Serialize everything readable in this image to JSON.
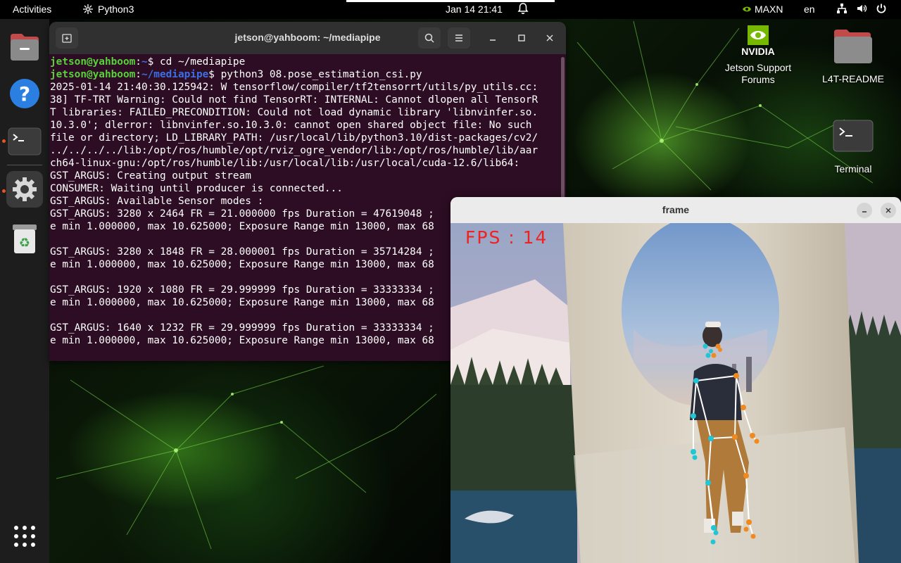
{
  "topbar": {
    "activities": "Activities",
    "app_name": "Python3",
    "clock": "Jan 14  21:41",
    "power_mode": "MAXN",
    "language": "en"
  },
  "dock": {
    "items": [
      {
        "name": "Files",
        "icon": "folder-icon"
      },
      {
        "name": "Help",
        "icon": "help-icon"
      },
      {
        "name": "Terminal",
        "icon": "terminal-icon"
      },
      {
        "name": "Settings",
        "icon": "settings-icon"
      },
      {
        "name": "Trash",
        "icon": "trash-icon"
      }
    ],
    "apps_grid_icon": "apps-grid-icon"
  },
  "desktop": {
    "icons": [
      {
        "label_line1": "Jetson Support",
        "label_line2": "Forums",
        "icon": "nvidia-logo"
      },
      {
        "label_line1": "L4T-README",
        "label_line2": "",
        "icon": "folder-icon"
      },
      {
        "label_line1": "Terminal",
        "label_line2": "",
        "icon": "terminal-icon"
      }
    ],
    "nvidia_logo_text": "NVIDIA"
  },
  "terminal": {
    "title": "jetson@yahboom: ~/mediapipe",
    "prompt_user": "jetson@yahboom",
    "prompt1_path": "~",
    "prompt1_cmd": "$ cd ~/mediapipe",
    "prompt2_path": "~/mediapipe",
    "prompt2_cmd": "$ python3 08.pose_estimation_csi.py",
    "lines": [
      "2025-01-14 21:40:30.125942: W tensorflow/compiler/tf2tensorrt/utils/py_utils.cc:",
      "38] TF-TRT Warning: Could not find TensorRT: INTERNAL: Cannot dlopen all TensorR",
      "T libraries: FAILED_PRECONDITION: Could not load dynamic library 'libnvinfer.so.",
      "10.3.0'; dlerror: libnvinfer.so.10.3.0: cannot open shared object file: No such",
      "file or directory; LD_LIBRARY_PATH: /usr/local/lib/python3.10/dist-packages/cv2/",
      "../../../../lib:/opt/ros/humble/opt/rviz_ogre_vendor/lib:/opt/ros/humble/lib/aar",
      "ch64-linux-gnu:/opt/ros/humble/lib:/usr/local/lib:/usr/local/cuda-12.6/lib64:",
      "GST_ARGUS: Creating output stream",
      "CONSUMER: Waiting until producer is connected...",
      "GST_ARGUS: Available Sensor modes :",
      "GST_ARGUS: 3280 x 2464 FR = 21.000000 fps Duration = 47619048 ;",
      "e min 1.000000, max 10.625000; Exposure Range min 13000, max 68",
      "",
      "GST_ARGUS: 3280 x 1848 FR = 28.000001 fps Duration = 35714284 ;",
      "e min 1.000000, max 10.625000; Exposure Range min 13000, max 68",
      "",
      "GST_ARGUS: 1920 x 1080 FR = 29.999999 fps Duration = 33333334 ;",
      "e min 1.000000, max 10.625000; Exposure Range min 13000, max 68",
      "",
      "GST_ARGUS: 1640 x 1232 FR = 29.999999 fps Duration = 33333334 ;",
      "e min 1.000000, max 10.625000; Exposure Range min 13000, max 68"
    ]
  },
  "frame": {
    "title": "frame",
    "fps_text": "FPS : 14"
  }
}
